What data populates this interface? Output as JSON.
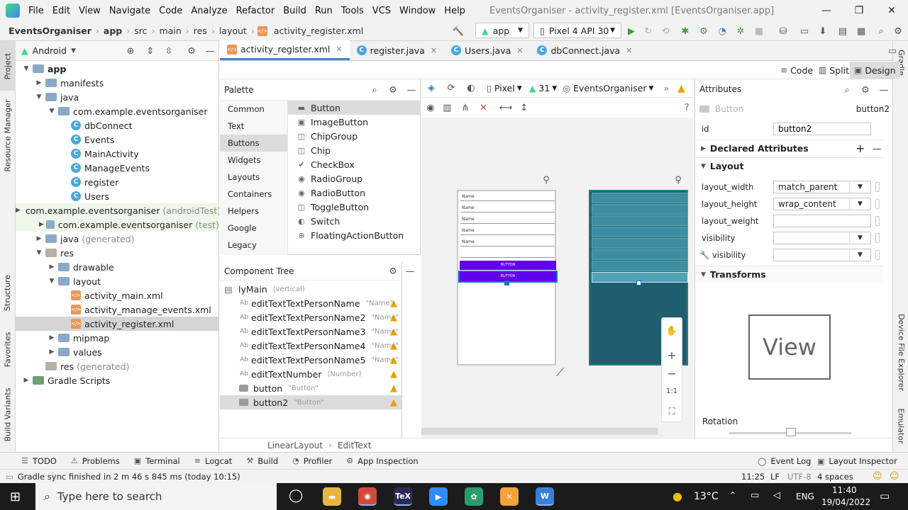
{
  "menubar": {
    "items": [
      "File",
      "Edit",
      "View",
      "Navigate",
      "Code",
      "Analyze",
      "Refactor",
      "Build",
      "Run",
      "Tools",
      "VCS",
      "Window",
      "Help"
    ],
    "window_title": "EventsOrganiser - activity_register.xml [EventsOrganiser.app]"
  },
  "navbar": {
    "crumbs": [
      "EventsOrganiser",
      "app",
      "src",
      "main",
      "res",
      "layout",
      "activity_register.xml"
    ],
    "run_config": "app",
    "device": "Pixel 4 API 30"
  },
  "side_tabs": {
    "left": [
      "Project",
      "Resource Manager",
      "Structure",
      "Favorites",
      "Build Variants"
    ],
    "right": [
      "Gradle",
      "Device File Explorer",
      "Emulator"
    ]
  },
  "project": {
    "view_mode": "Android",
    "tree": [
      {
        "label": "app",
        "depth": 0,
        "kind": "folder",
        "bold": true,
        "arrow": "down"
      },
      {
        "label": "manifests",
        "depth": 1,
        "kind": "folder",
        "arrow": "right"
      },
      {
        "label": "java",
        "depth": 1,
        "kind": "folder",
        "arrow": "down"
      },
      {
        "label": "com.example.eventsorganiser",
        "depth": 2,
        "kind": "folder",
        "arrow": "down"
      },
      {
        "label": "dbConnect",
        "depth": 3,
        "kind": "class"
      },
      {
        "label": "Events",
        "depth": 3,
        "kind": "class"
      },
      {
        "label": "MainActivity",
        "depth": 3,
        "kind": "class"
      },
      {
        "label": "ManageEvents",
        "depth": 3,
        "kind": "class"
      },
      {
        "label": "register",
        "depth": 3,
        "kind": "class"
      },
      {
        "label": "Users",
        "depth": 3,
        "kind": "class"
      },
      {
        "label": "com.example.eventsorganiser",
        "suffix": "(androidTest)",
        "depth": 2,
        "kind": "folder",
        "arrow": "right",
        "green": true
      },
      {
        "label": "com.example.eventsorganiser",
        "suffix": "(test)",
        "depth": 2,
        "kind": "folder",
        "arrow": "right",
        "green": true
      },
      {
        "label": "java",
        "suffix": "(generated)",
        "depth": 1,
        "kind": "folder",
        "arrow": "right"
      },
      {
        "label": "res",
        "depth": 1,
        "kind": "res",
        "arrow": "down"
      },
      {
        "label": "drawable",
        "depth": 2,
        "kind": "folder",
        "arrow": "right"
      },
      {
        "label": "layout",
        "depth": 2,
        "kind": "folder",
        "arrow": "down"
      },
      {
        "label": "activity_main.xml",
        "depth": 3,
        "kind": "xml"
      },
      {
        "label": "activity_manage_events.xml",
        "depth": 3,
        "kind": "xml"
      },
      {
        "label": "activity_register.xml",
        "depth": 3,
        "kind": "xml",
        "selected": true
      },
      {
        "label": "mipmap",
        "depth": 2,
        "kind": "folder",
        "arrow": "right"
      },
      {
        "label": "values",
        "depth": 2,
        "kind": "folder",
        "arrow": "right"
      },
      {
        "label": "res",
        "suffix": "(generated)",
        "depth": 1,
        "kind": "res"
      },
      {
        "label": "Gradle Scripts",
        "depth": 0,
        "kind": "gradle",
        "arrow": "right"
      }
    ]
  },
  "editor_tabs": [
    {
      "label": "activity_register.xml",
      "active": true,
      "kind": "xml"
    },
    {
      "label": "register.java",
      "kind": "class"
    },
    {
      "label": "Users.java",
      "kind": "class"
    },
    {
      "label": "dbConnect.java",
      "kind": "class"
    }
  ],
  "modes": [
    "Code",
    "Split",
    "Design"
  ],
  "palette": {
    "title": "Palette",
    "categories": [
      "Common",
      "Text",
      "Buttons",
      "Widgets",
      "Layouts",
      "Containers",
      "Helpers",
      "Google",
      "Legacy"
    ],
    "selected_category": "Buttons",
    "items": [
      "Button",
      "ImageButton",
      "ChipGroup",
      "Chip",
      "CheckBox",
      "RadioGroup",
      "RadioButton",
      "ToggleButton",
      "Switch",
      "FloatingActionButton"
    ],
    "item_icons": [
      "▬",
      "▣",
      "◫",
      "◫",
      "✔",
      "◉",
      "◉",
      "◫",
      "◐",
      "⊕"
    ]
  },
  "component_tree": {
    "title": "Component Tree",
    "root": {
      "label": "lyMain",
      "hint": "(vertical)"
    },
    "nodes": [
      {
        "label": "editTextTextPersonName",
        "hint": "\"Name\"",
        "kind": "Ab"
      },
      {
        "label": "editTextTextPersonName2",
        "hint": "\"Name\"",
        "kind": "Ab"
      },
      {
        "label": "editTextTextPersonName3",
        "hint": "\"Name\"",
        "kind": "Ab"
      },
      {
        "label": "editTextTextPersonName4",
        "hint": "\"Name\"",
        "kind": "Ab"
      },
      {
        "label": "editTextTextPersonName5",
        "hint": "\"Name\"",
        "kind": "Ab"
      },
      {
        "label": "editTextNumber",
        "hint": "(Number)",
        "kind": "Ab"
      },
      {
        "label": "button",
        "hint": "\"Button\"",
        "kind": "btn"
      },
      {
        "label": "button2",
        "hint": "\"Button\"",
        "kind": "btn",
        "selected": true
      }
    ]
  },
  "design_toolbar": {
    "device": "Pixel",
    "api": "31",
    "theme": "EventsOrganiser"
  },
  "preview": {
    "field_hints": [
      "Name",
      "Name",
      "Name",
      "Name",
      "Name"
    ],
    "button_labels": [
      "BUTTON",
      "BUTTON"
    ],
    "zoom_ratio": "1:1"
  },
  "attributes": {
    "title": "Attributes",
    "component_type": "Button",
    "component_id": "button2",
    "id_label": "id",
    "id_value": "button2",
    "sections": {
      "declared": "Declared Attributes",
      "layout": "Layout",
      "transforms": "Transforms"
    },
    "layout_rows": [
      {
        "label": "layout_width",
        "value": "match_parent",
        "dropdown": true
      },
      {
        "label": "layout_height",
        "value": "wrap_content",
        "dropdown": true
      },
      {
        "label": "layout_weight",
        "value": "",
        "dropdown": false
      },
      {
        "label": "visibility",
        "value": "",
        "dropdown": true
      },
      {
        "label": "visibility",
        "value": "",
        "dropdown": true,
        "tool": true
      }
    ],
    "view_preview": "View",
    "rotation_label": "Rotation"
  },
  "layout_breadcrumb": [
    "LinearLayout",
    "EditText"
  ],
  "bottom_tools": [
    "TODO",
    "Problems",
    "Terminal",
    "Logcat",
    "Build",
    "Profiler",
    "App Inspection"
  ],
  "bottom_tools_right": [
    "Event Log",
    "Layout Inspector"
  ],
  "status": {
    "message": "Gradle sync finished in 2 m 46 s 845 ms (today 10:15)",
    "position": "11:25",
    "line_sep": "LF",
    "encoding": "UTF-8",
    "indent": "4 spaces"
  },
  "taskbar": {
    "search_placeholder": "Type here to search",
    "weather": "13°C",
    "lang": "ENG",
    "time": "11:40",
    "date": "19/04/2022"
  }
}
